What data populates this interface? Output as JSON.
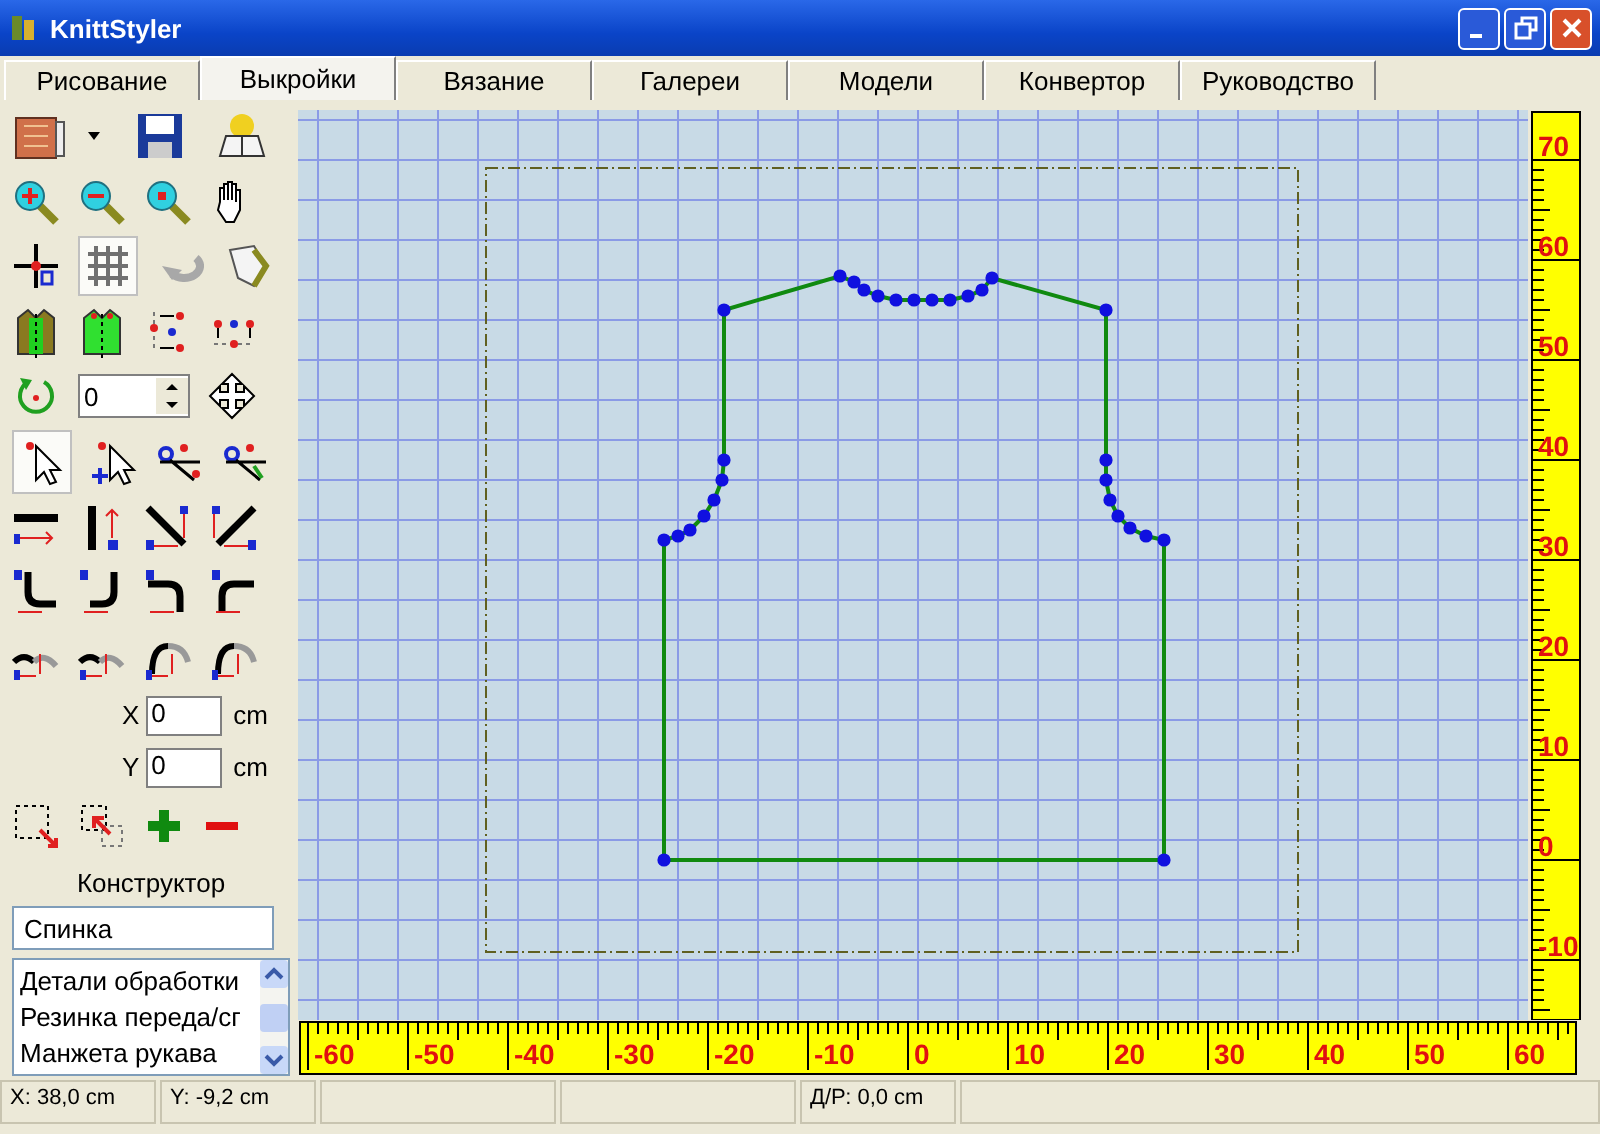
{
  "window": {
    "title": "KnittStyler"
  },
  "tabs": [
    {
      "label": "Рисование",
      "selected": false
    },
    {
      "label": "Выкройки",
      "selected": true
    },
    {
      "label": "Вязание",
      "selected": false
    },
    {
      "label": "Галереи",
      "selected": false
    },
    {
      "label": "Модели",
      "selected": false
    },
    {
      "label": "Конвертор",
      "selected": false
    },
    {
      "label": "Руководство",
      "selected": false
    }
  ],
  "toolbar": {
    "grid_on": true,
    "select_mode": true,
    "rotation": "0",
    "x_label": "X",
    "x_value": "0",
    "x_unit": "cm",
    "y_label": "Y",
    "y_value": "0",
    "y_unit": "cm"
  },
  "constructor": {
    "title": "Конструктор",
    "piece_name": "Спинка",
    "items": [
      "Детали обработки",
      "Резинка переда/сг",
      "Манжета рукава"
    ]
  },
  "rulers": {
    "horizontal": [
      "-60",
      "-50",
      "-40",
      "-30",
      "-20",
      "-10",
      "0",
      "10",
      "20",
      "30",
      "40",
      "50",
      "60"
    ],
    "vertical": [
      "70",
      "60",
      "50",
      "40",
      "30",
      "20",
      "10",
      "0",
      "-10"
    ]
  },
  "status_bar": {
    "x": "X: 38,0 cm",
    "y": "Y: -9,2 cm",
    "length": "Д/Р: 0,0 cm"
  }
}
